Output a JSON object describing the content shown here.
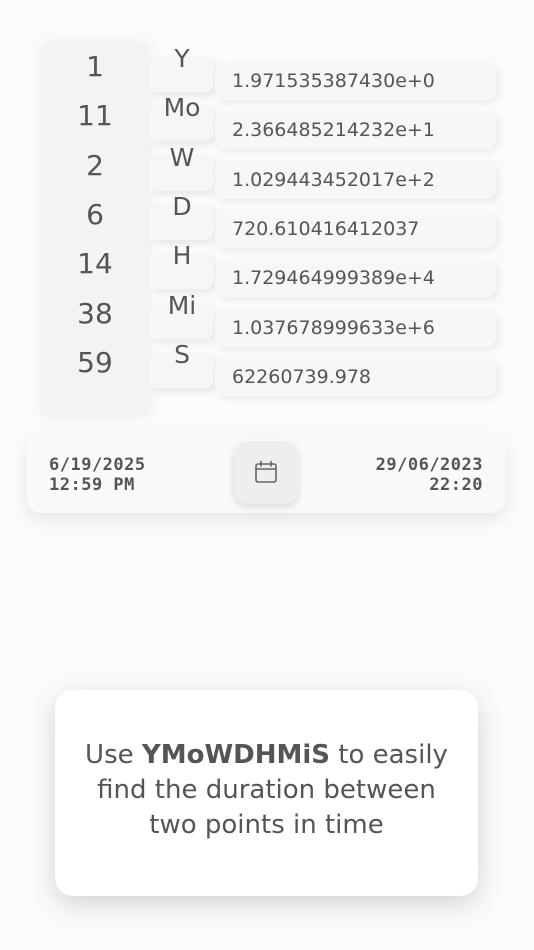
{
  "durations": [
    {
      "count": "1",
      "unit": "Y",
      "value": "1.971535387430e+0"
    },
    {
      "count": "11",
      "unit": "Mo",
      "value": "2.366485214232e+1"
    },
    {
      "count": "2",
      "unit": "W",
      "value": "1.029443452017e+2"
    },
    {
      "count": "6",
      "unit": "D",
      "value": "720.610416412037"
    },
    {
      "count": "14",
      "unit": "H",
      "value": "1.729464999389e+4"
    },
    {
      "count": "38",
      "unit": "Mi",
      "value": "1.037678999633e+6"
    },
    {
      "count": "59",
      "unit": "S",
      "value": "62260739.978"
    }
  ],
  "date_range": {
    "start_date": "6/19/2025",
    "start_time": "12:59 PM",
    "end_date": "29/06/2023",
    "end_time": "22:20",
    "calendar_icon": "calendar-icon"
  },
  "info": {
    "prefix": "Use ",
    "app_name": "YMoWDHMiS",
    "suffix_line1": " to easily",
    "line2": "find the duration between",
    "line3": "two points in time"
  },
  "colors": {
    "background": "#fbfbfb",
    "text": "#555555",
    "panel": "#f3f3f3"
  }
}
